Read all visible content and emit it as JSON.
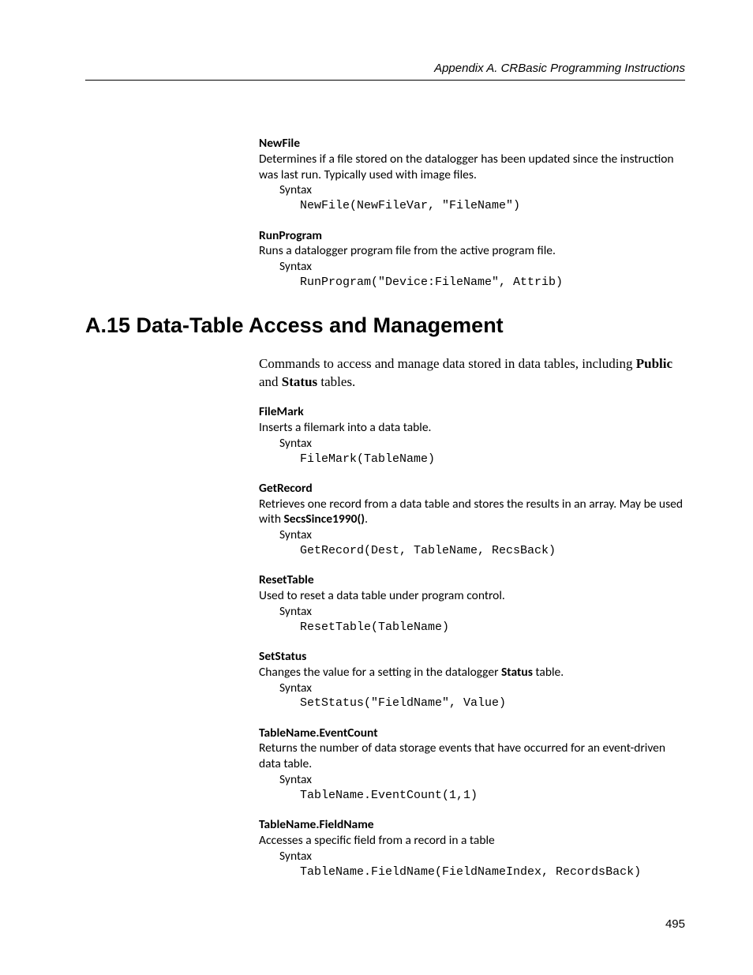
{
  "running_head": "Appendix A.  CRBasic Programming Instructions",
  "page_number": "495",
  "pre_section_entries": [
    {
      "title": "NewFile",
      "desc": "Determines if a file stored on the datalogger has been updated since the instruction was last run. Typically used with image files.",
      "syntax_label": "Syntax",
      "code": "NewFile(NewFileVar, \"FileName\")"
    },
    {
      "title": "RunProgram",
      "desc": "Runs a datalogger program file from the active program file.",
      "syntax_label": "Syntax",
      "code": "RunProgram(\"Device:FileName\", Attrib)"
    }
  ],
  "section_heading": "A.15 Data-Table Access and Management",
  "section_intro_parts": {
    "pre": "Commands to access and manage data stored in data tables, including ",
    "b1": "Public",
    "mid": " and ",
    "b2": "Status",
    "post": " tables."
  },
  "entries": [
    {
      "title": "FileMark",
      "desc": "Inserts a filemark into a data table.",
      "syntax_label": "Syntax",
      "code": "FileMark(TableName)"
    },
    {
      "title": "GetRecord",
      "desc_parts": {
        "pre": "Retrieves one record from a data table and stores the results in an array. May be used with ",
        "b": "SecsSince1990()",
        "post": "."
      },
      "syntax_label": "Syntax",
      "code": "GetRecord(Dest, TableName, RecsBack)"
    },
    {
      "title": "ResetTable",
      "desc": "Used to reset a data table under program control.",
      "syntax_label": "Syntax",
      "code": "ResetTable(TableName)"
    },
    {
      "title": "SetStatus",
      "desc_parts": {
        "pre": "Changes the value for a setting in the datalogger ",
        "b": "Status",
        "post": " table."
      },
      "syntax_label": "Syntax",
      "code": "SetStatus(\"FieldName\", Value)"
    },
    {
      "title": "TableName.EventCount",
      "desc": "Returns the number of data storage events that have occurred for an event-driven data table.",
      "syntax_label": "Syntax",
      "code": "TableName.EventCount(1,1)"
    },
    {
      "title": "TableName.FieldName",
      "desc": "Accesses a specific field from a record in a table",
      "syntax_label": "Syntax",
      "code": "TableName.FieldName(FieldNameIndex, RecordsBack)"
    }
  ]
}
